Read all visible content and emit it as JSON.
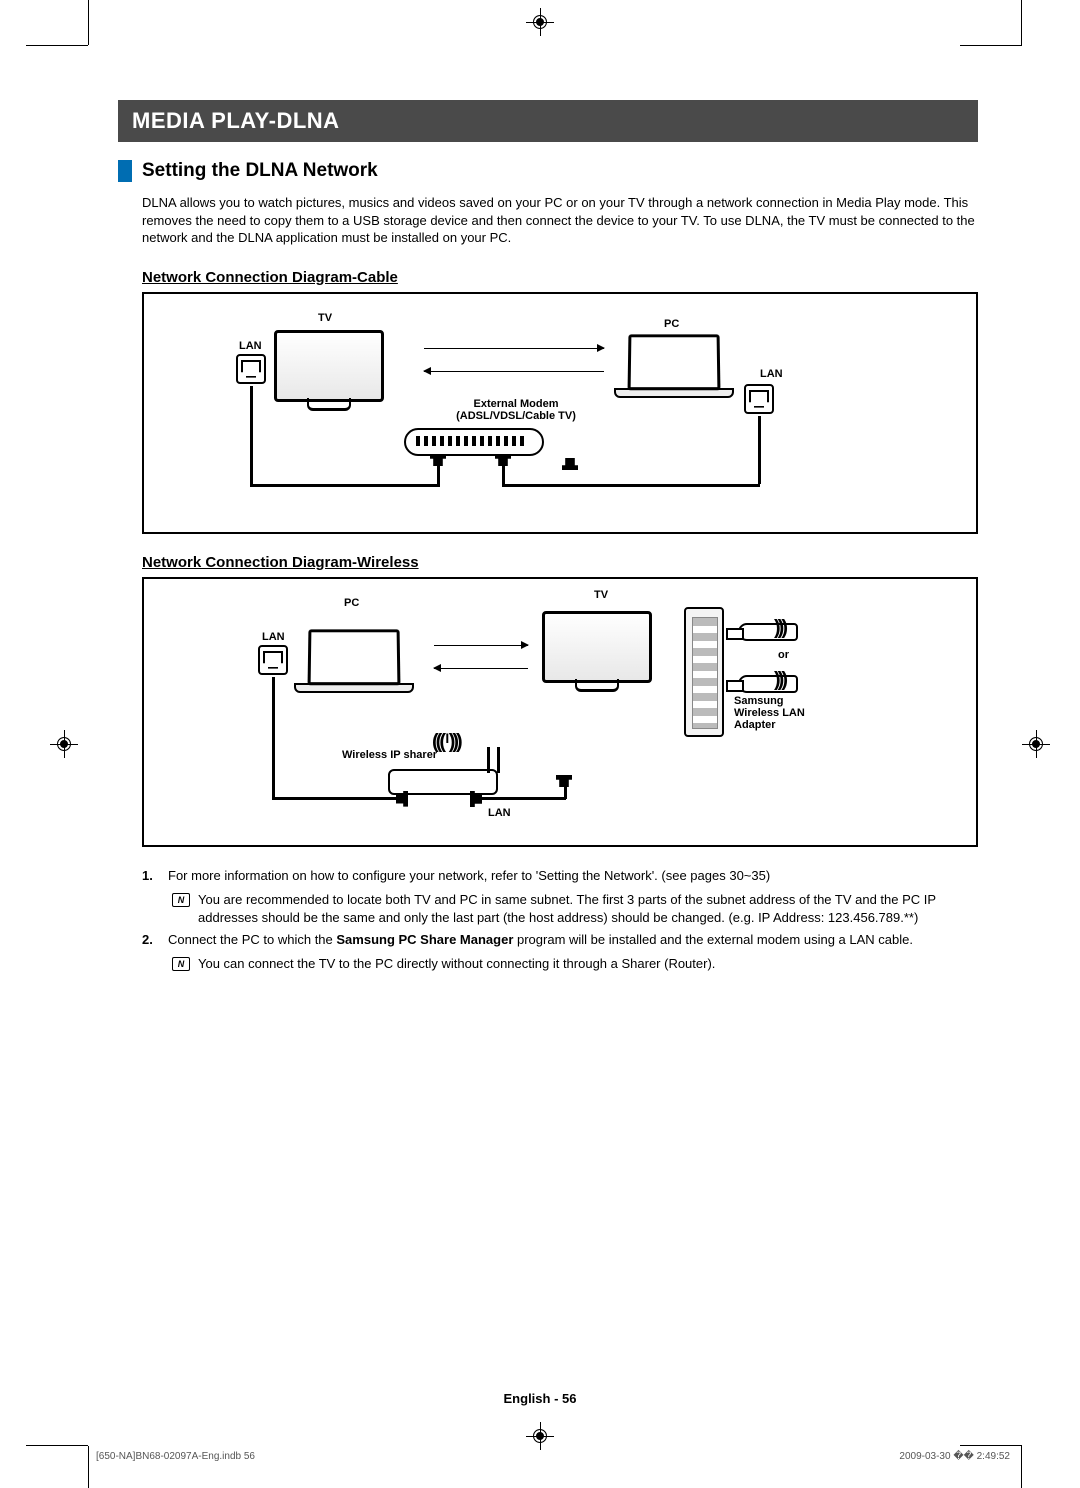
{
  "chapter_title": "MEDIA PLAY-DLNA",
  "section_title": "Setting the DLNA Network",
  "intro_text": "DLNA allows you to watch pictures, musics and videos saved on your PC or on your TV through a network connection in Media Play mode. This removes the need to copy them to a USB storage device and then connect the device to your TV. To use DLNA, the TV must be connected to the network and the DLNA application must be installed on your PC.",
  "sub1_title": "Network Connection Diagram-Cable",
  "sub2_title": "Network Connection Diagram-Wireless",
  "diagram_cable": {
    "tv_label": "TV",
    "pc_label": "PC",
    "lan_left": "LAN",
    "lan_right": "LAN",
    "modem_label_line1": "External Modem",
    "modem_label_line2": "(ADSL/VDSL/Cable TV)"
  },
  "diagram_wireless": {
    "pc_label": "PC",
    "tv_label": "TV",
    "lan_left": "LAN",
    "lan_bottom": "LAN",
    "router_label": "Wireless IP sharer",
    "or_label": "or",
    "adapter_label_line1": "Samsung",
    "adapter_label_line2": "Wireless LAN",
    "adapter_label_line3": "Adapter"
  },
  "list": {
    "item1_num": "1.",
    "item1_text": "For more information on how to configure your network, refer to 'Setting the Network'. (see pages 30~35)",
    "note1_text": "You are recommended to locate both TV and PC in same subnet. The first 3 parts of the subnet address of the TV and the PC IP addresses should be the same and only the last part (the host address) should be changed. (e.g. IP Address: 123.456.789.**)",
    "item2_num": "2.",
    "item2_text_prefix": "Connect the PC to which the ",
    "item2_text_bold": "Samsung PC Share Manager",
    "item2_text_suffix": " program will be installed and the external modem using a LAN cable.",
    "note2_text": "You can connect the TV to the PC directly without connecting it through a Sharer (Router)."
  },
  "footer_text": "English - 56",
  "print_left": "[650-NA]BN68-02097A-Eng.indb   56",
  "print_right": "2009-03-30   �� 2:49:52"
}
